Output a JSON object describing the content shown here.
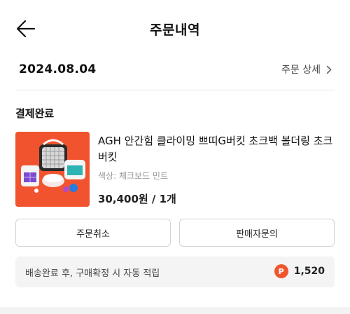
{
  "header": {
    "title": "주문내역"
  },
  "order": {
    "date": "2024.08.04",
    "detail_link": "주문 상세"
  },
  "status": "결제완료",
  "product": {
    "name": "AGH 안간힘 클라이밍 쁘띠G버킷 초크백 볼더링 초크버킷",
    "option": "색상: 체크보드 민트",
    "price": "30,400원 / 1개"
  },
  "buttons": {
    "cancel": "주문취소",
    "inquiry": "판매자문의"
  },
  "points": {
    "text": "배송완료 후, 구매확정 시 자동 적립",
    "badge": "P",
    "amount": "1,520"
  },
  "colors": {
    "accent": "#f0562d",
    "thumb_bg": "#f2532f"
  }
}
